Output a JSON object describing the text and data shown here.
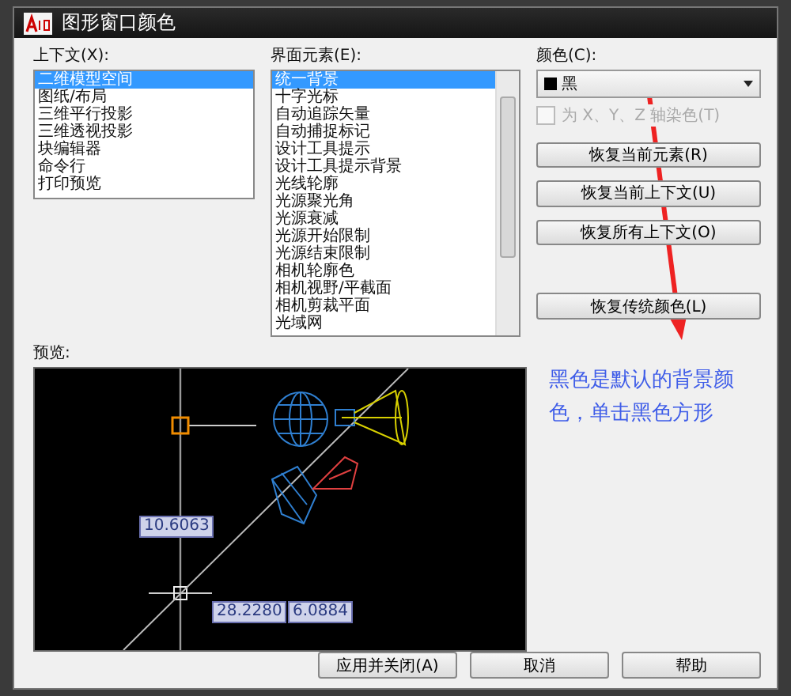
{
  "window": {
    "title": "图形窗口颜色"
  },
  "context": {
    "label": "上下文(X):",
    "items": [
      {
        "label": "二维模型空间",
        "selected": true
      },
      {
        "label": "图纸/布局",
        "selected": false
      },
      {
        "label": "三维平行投影",
        "selected": false
      },
      {
        "label": "三维透视投影",
        "selected": false
      },
      {
        "label": "块编辑器",
        "selected": false
      },
      {
        "label": "命令行",
        "selected": false
      },
      {
        "label": "打印预览",
        "selected": false
      }
    ]
  },
  "elements": {
    "label": "界面元素(E):",
    "items": [
      {
        "label": "统一背景",
        "selected": true
      },
      {
        "label": "十字光标",
        "selected": false
      },
      {
        "label": "自动追踪矢量",
        "selected": false
      },
      {
        "label": "自动捕捉标记",
        "selected": false
      },
      {
        "label": "设计工具提示",
        "selected": false
      },
      {
        "label": "设计工具提示背景",
        "selected": false
      },
      {
        "label": "光线轮廓",
        "selected": false
      },
      {
        "label": "光源聚光角",
        "selected": false
      },
      {
        "label": "光源衰减",
        "selected": false
      },
      {
        "label": "光源开始限制",
        "selected": false
      },
      {
        "label": "光源结束限制",
        "selected": false
      },
      {
        "label": "相机轮廓色",
        "selected": false
      },
      {
        "label": "相机视野/平截面",
        "selected": false
      },
      {
        "label": "相机剪裁平面",
        "selected": false
      },
      {
        "label": "光域网",
        "selected": false
      }
    ]
  },
  "color": {
    "label": "颜色(C):",
    "value": "黑"
  },
  "axis_tint": {
    "label": "为 X、Y、Z 轴染色(T)",
    "checked": false,
    "disabled": true
  },
  "restore_buttons": [
    "恢复当前元素(R)",
    "恢复当前上下文(U)",
    "恢复所有上下文(O)",
    "恢复传统颜色(L)"
  ],
  "preview": {
    "label": "预览:",
    "readouts": [
      "10.6063",
      "28.2280",
      "6.0884"
    ]
  },
  "buttons": [
    "应用并关闭(A)",
    "取消",
    "帮助"
  ],
  "annotation": {
    "text": "黑色是默认的背景颜色，单击黑色方形"
  }
}
